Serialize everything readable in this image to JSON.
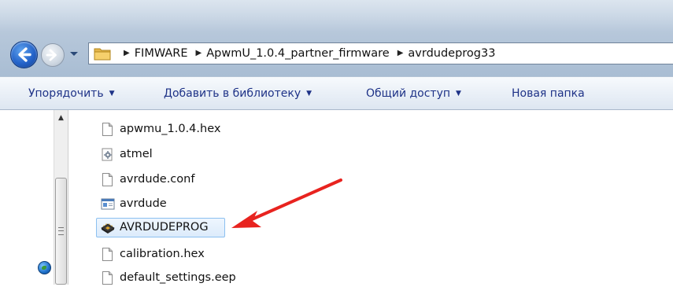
{
  "address": {
    "crumbs": [
      "FIMWARE",
      "ApwmU_1.0.4_partner_firmware",
      "avrdudeprog33"
    ]
  },
  "toolbar": {
    "organize": "Упорядочить",
    "add_to_library": "Добавить в библиотеку",
    "share": "Общий доступ",
    "new_folder": "Новая папка"
  },
  "files": [
    {
      "name": "apwmu_1.0.4.hex",
      "icon": "document-icon"
    },
    {
      "name": "atmel",
      "icon": "settings-file-icon"
    },
    {
      "name": "avrdude.conf",
      "icon": "document-icon"
    },
    {
      "name": "avrdude",
      "icon": "application-icon"
    },
    {
      "name": "AVRDUDEPROG",
      "icon": "chip-program-icon",
      "selected": true
    },
    {
      "name": "calibration.hex",
      "icon": "document-icon"
    },
    {
      "name": "default_settings.eep",
      "icon": "document-icon"
    }
  ],
  "colors": {
    "toolbar_text": "#1e3287",
    "selection_border": "#8cc0f0",
    "annotation_arrow": "#e8231f"
  }
}
